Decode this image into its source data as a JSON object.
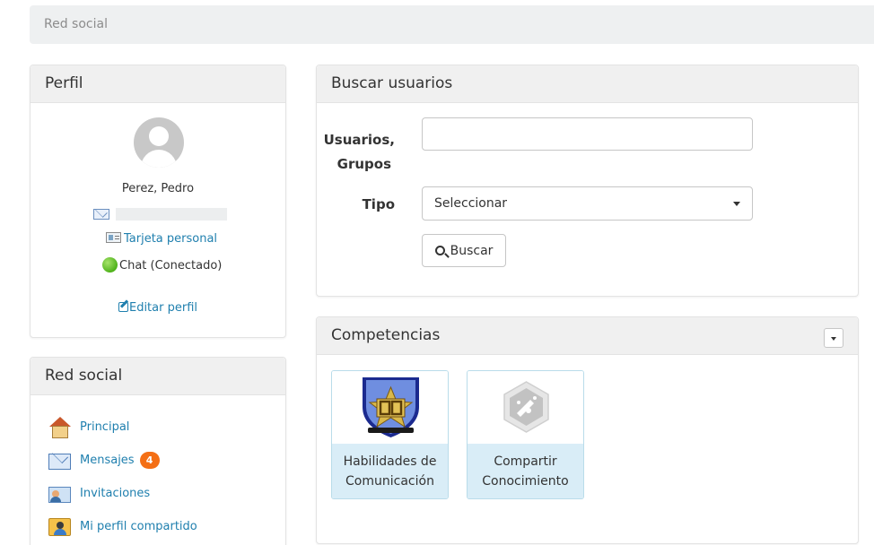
{
  "breadcrumb": {
    "label": "Red social"
  },
  "profile_panel": {
    "title": "Perfil",
    "name": "Perez, Pedro",
    "business_card_link": "Tarjeta personal",
    "chat_status": "Chat (Conectado)",
    "edit_profile_link": "Editar perfil"
  },
  "social_panel": {
    "title": "Red social",
    "items": [
      {
        "label": "Principal",
        "icon": "home-icon"
      },
      {
        "label": "Mensajes",
        "icon": "envelope-icon",
        "badge": "4"
      },
      {
        "label": "Invitaciones",
        "icon": "invitation-icon"
      },
      {
        "label": "Mi perfil compartido",
        "icon": "shared-profile-icon"
      }
    ]
  },
  "search_panel": {
    "title": "Buscar usuarios",
    "users_label_line1": "Usuarios,",
    "users_label_line2": "Grupos",
    "users_value": "",
    "type_label": "Tipo",
    "type_selected": "Seleccionar",
    "search_button": "Buscar"
  },
  "skills_panel": {
    "title": "Competencias",
    "badges": [
      {
        "name_line1": "Habilidades de",
        "name_line2": "Comunicación",
        "image": "communication-badge"
      },
      {
        "name_line1": "Compartir",
        "name_line2": "Conocimiento",
        "image": "knowledge-badge"
      }
    ]
  },
  "colors": {
    "link": "#1f7fae",
    "badge_counter": "#f46f15",
    "panel_heading": "#f0f0f0",
    "card_caption": "#d9edf7"
  }
}
